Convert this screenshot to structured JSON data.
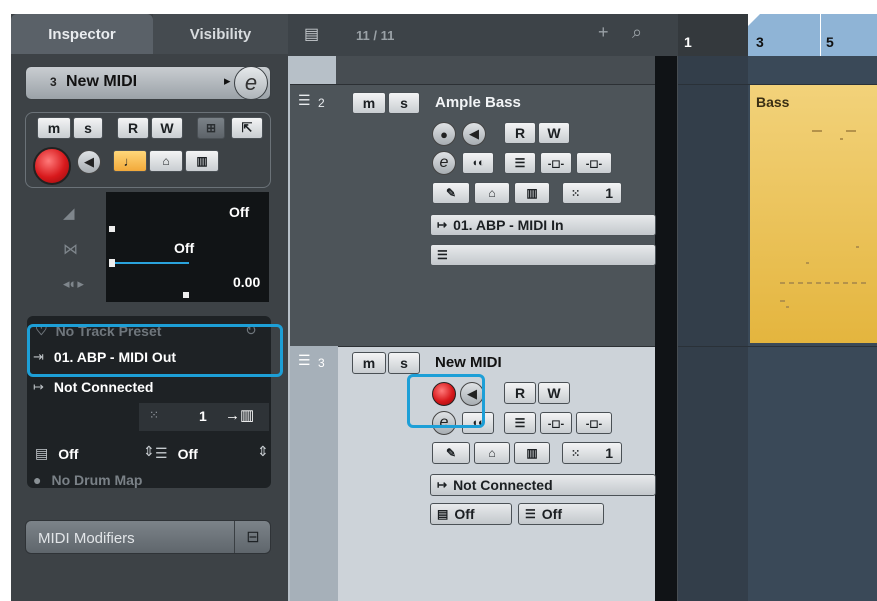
{
  "inspector": {
    "tabs": [
      {
        "label": "Inspector"
      },
      {
        "label": "Visibility"
      }
    ],
    "track_number": "3",
    "track_name": "New MIDI",
    "buttons": {
      "mute": "m",
      "solo": "s",
      "read": "R",
      "write": "W"
    },
    "volume_value": "Off",
    "pan_value": "Off",
    "delay_value": "0.00",
    "preset_label": "No Track Preset",
    "midi_output": "01. ABP - MIDI Out",
    "midi_input": "Not Connected",
    "channel_value": "1",
    "bank_value": "Off",
    "program_value": "Off",
    "drum_map": "No Drum Map",
    "midi_modifiers": "MIDI Modifiers"
  },
  "toolbar": {
    "track_count": "11 / 11",
    "add_symbol": "+",
    "search_symbol": "⌕"
  },
  "tracks": [
    {
      "number": "2",
      "name": "Ample Bass",
      "mute": "m",
      "solo": "s",
      "read": "R",
      "write": "W",
      "channel": "1",
      "input_routing": "01. ABP - MIDI In",
      "output_routing": ""
    },
    {
      "number": "3",
      "name": "New MIDI",
      "mute": "m",
      "solo": "s",
      "read": "R",
      "write": "W",
      "channel": "1",
      "input_routing": "Not Connected",
      "bank": "Off",
      "program": "Off"
    }
  ],
  "ruler": {
    "marks": [
      "1",
      "3",
      "5"
    ]
  },
  "clips": [
    {
      "name": "Bass",
      "color": "#e8c766"
    }
  ],
  "colors": {
    "highlight": "#1d9fd7",
    "record": "#d8191c",
    "selected_track": "#cdd3d9"
  }
}
